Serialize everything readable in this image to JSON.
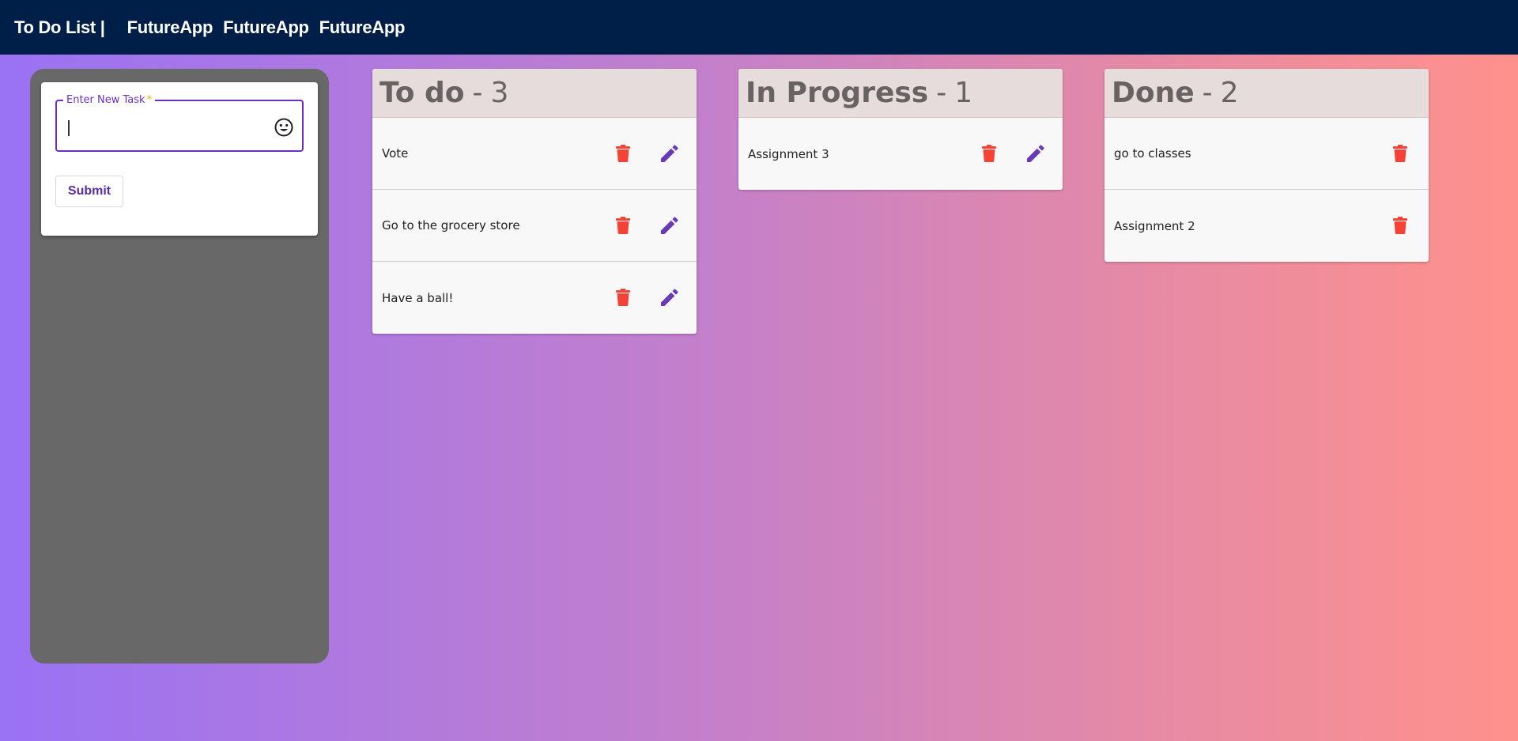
{
  "nav": {
    "brand": "To Do List |",
    "links": [
      "FutureApp",
      "FutureApp",
      "FutureApp"
    ]
  },
  "form": {
    "label": "Enter New Task",
    "required_mark": "*",
    "value": "",
    "submit_label": "Submit",
    "emoji_icon": "emoji-smile-icon"
  },
  "columns": [
    {
      "name": "To do",
      "separator": "-",
      "count": "3",
      "tasks": [
        "Vote",
        "Go to the grocery store",
        "Have a ball!"
      ]
    },
    {
      "name": "In Progress",
      "separator": "-",
      "count": "1",
      "tasks": [
        "Assignment 3"
      ]
    },
    {
      "name": "Done",
      "separator": "-",
      "count": "2",
      "tasks": [
        "go to classes",
        "Assignment 2"
      ]
    }
  ],
  "colors": {
    "navbar": "#001f48",
    "delete_icon": "#f44336",
    "edit_icon": "#673ab7",
    "accent": "#6a2fc7",
    "panel": "#686868"
  }
}
